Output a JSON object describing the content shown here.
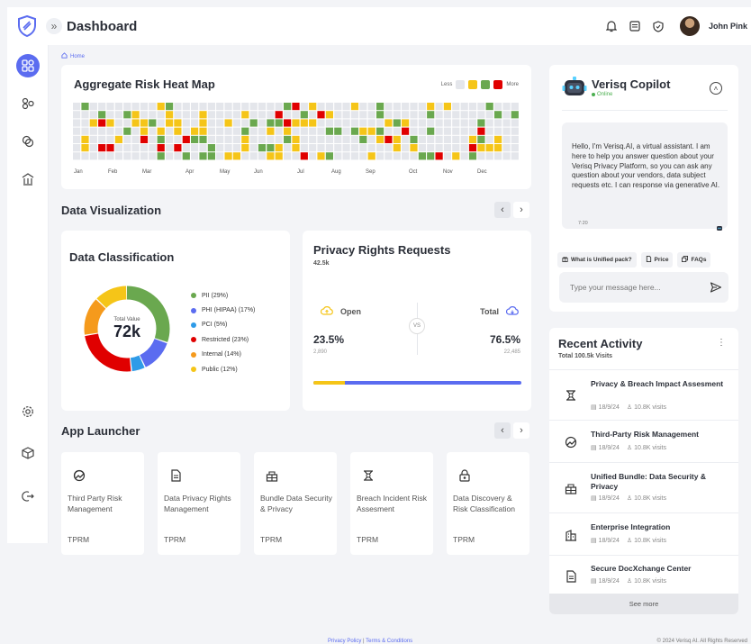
{
  "header": {
    "title": "Dashboard",
    "user_name": "John Pink"
  },
  "breadcrumb": {
    "home": "Home"
  },
  "heatmap": {
    "title": "Aggregate Risk Heat Map",
    "legend_less": "Less",
    "legend_more": "More",
    "months": [
      "Jan",
      "Feb",
      "Mar",
      "Apr",
      "May",
      "Jun",
      "Jul",
      "Aug",
      "Sep",
      "Oct",
      "Nov",
      "Dec"
    ],
    "colors": {
      "empty": "#e4e6eb",
      "yellow": "#f5c518",
      "green": "#6aa84f",
      "red": "#e00000"
    }
  },
  "data_visualization": {
    "title": "Data Visualization"
  },
  "data_classification": {
    "title": "Data Classification",
    "center_label": "Total Value",
    "center_value": "72k",
    "legend": [
      {
        "label": "PII (29%)",
        "color": "#6aa84f",
        "pct": 29
      },
      {
        "label": "PHI (HIPAA) (17%)",
        "color": "#5b6cf0",
        "pct": 12
      },
      {
        "label": "PCI (5%)",
        "color": "#2e9be8",
        "pct": 5
      },
      {
        "label": "Restricted (23%)",
        "color": "#e00000",
        "pct": 23
      },
      {
        "label": "Internal (14%)",
        "color": "#f59a1c",
        "pct": 14
      },
      {
        "label": "Public (12%)",
        "color": "#f5c518",
        "pct": 12
      }
    ]
  },
  "privacy_rights": {
    "title": "Privacy Rights Requests",
    "subtitle": "42.5k",
    "open_label": "Open",
    "total_label": "Total",
    "vs": "VS",
    "open_pct": "23.5%",
    "open_count": "2,890",
    "total_pct": "76.5%",
    "total_count": "22,485",
    "open_fraction": 0.15
  },
  "app_launcher": {
    "title": "App Launcher",
    "apps": [
      {
        "name": "Third Party Risk Management",
        "code": "TPRM",
        "icon": "risk-icon"
      },
      {
        "name": "Data Privacy Rights Management",
        "code": "TPRM",
        "icon": "document-icon"
      },
      {
        "name": "Bundle Data Security & Privacy",
        "code": "TPRM",
        "icon": "bundle-icon"
      },
      {
        "name": "Breach Incident Risk Assesment",
        "code": "TPRM",
        "icon": "breach-icon"
      },
      {
        "name": "Data Discovery & Risk Classification",
        "code": "TPRM",
        "icon": "discovery-icon"
      }
    ]
  },
  "copilot": {
    "title": "Verisq Copilot",
    "status": "Online",
    "message": "Hello, I'm Verisq.AI, a virtual assistant. I am here to help you answer question about your Verisq Privacy Platform, so you can ask any question about your vendors, data subject requests etc. I can response via generative AI.",
    "time": "7:20",
    "chips": [
      "What is Unified pack?",
      "Price",
      "FAQs"
    ],
    "input_placeholder": "Type your message here..."
  },
  "recent_activity": {
    "title": "Recent Activity",
    "subtitle": "Total 100.5k Visits",
    "items": [
      {
        "title": "Privacy & Breach Impact Assesment",
        "date": "18/9/24",
        "visits": "10.8K visits",
        "icon": "breach-icon"
      },
      {
        "title": "Third-Party Risk Management",
        "date": "18/9/24",
        "visits": "10.8K visits",
        "icon": "risk-icon"
      },
      {
        "title": "Unified Bundle: Data Security & Privacy",
        "date": "18/9/24",
        "visits": "10.8K visits",
        "icon": "bundle-icon"
      },
      {
        "title": "Enterprise Integration",
        "date": "18/9/24",
        "visits": "10.8K visits",
        "icon": "integration-icon"
      },
      {
        "title": "Secure DocXchange Center",
        "date": "18/9/24",
        "visits": "10.8K visits",
        "icon": "document-icon"
      }
    ],
    "see_more": "See more"
  },
  "footer": {
    "privacy": "Privacy Policy",
    "separator": "|",
    "terms": "Terms & Conditions",
    "copyright": "© 2024 Verisq AI. All Rights Reserved"
  }
}
